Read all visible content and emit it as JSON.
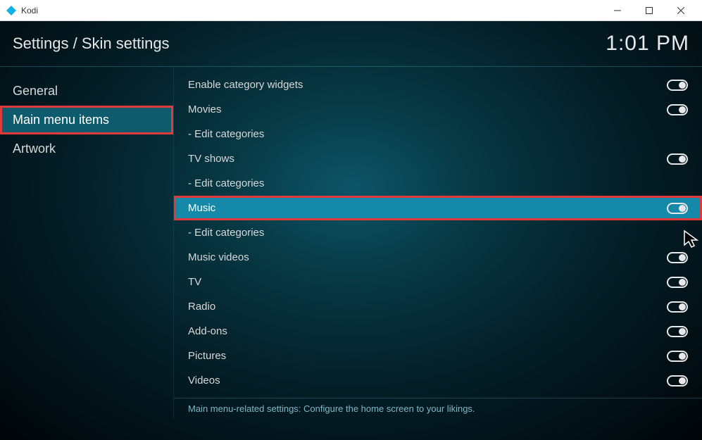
{
  "window": {
    "title": "Kodi"
  },
  "header": {
    "breadcrumb": "Settings / Skin settings",
    "clock": "1:01 PM"
  },
  "sidebar": {
    "items": [
      {
        "label": "General",
        "active": false,
        "highlighted": false
      },
      {
        "label": "Main menu items",
        "active": true,
        "highlighted": true
      },
      {
        "label": "Artwork",
        "active": false,
        "highlighted": false
      }
    ]
  },
  "settings": {
    "rows": [
      {
        "label": "Enable category widgets",
        "type": "toggle",
        "state": "on",
        "selected": false,
        "highlighted": false
      },
      {
        "label": "Movies",
        "type": "toggle",
        "state": "on",
        "selected": false,
        "highlighted": false
      },
      {
        "label": "- Edit categories",
        "type": "none",
        "state": "",
        "selected": false,
        "highlighted": false
      },
      {
        "label": "TV shows",
        "type": "toggle",
        "state": "on",
        "selected": false,
        "highlighted": false
      },
      {
        "label": "- Edit categories",
        "type": "none",
        "state": "",
        "selected": false,
        "highlighted": false
      },
      {
        "label": "Music",
        "type": "toggle",
        "state": "on",
        "selected": true,
        "highlighted": true
      },
      {
        "label": "- Edit categories",
        "type": "none",
        "state": "",
        "selected": false,
        "highlighted": false
      },
      {
        "label": "Music videos",
        "type": "toggle",
        "state": "on",
        "selected": false,
        "highlighted": false
      },
      {
        "label": "TV",
        "type": "toggle",
        "state": "on",
        "selected": false,
        "highlighted": false
      },
      {
        "label": "Radio",
        "type": "toggle",
        "state": "on",
        "selected": false,
        "highlighted": false
      },
      {
        "label": "Add-ons",
        "type": "toggle",
        "state": "on",
        "selected": false,
        "highlighted": false
      },
      {
        "label": "Pictures",
        "type": "toggle",
        "state": "on",
        "selected": false,
        "highlighted": false
      },
      {
        "label": "Videos",
        "type": "toggle",
        "state": "on",
        "selected": false,
        "highlighted": false
      }
    ]
  },
  "footer": {
    "text": "Main menu-related settings: Configure the home screen to your likings."
  }
}
